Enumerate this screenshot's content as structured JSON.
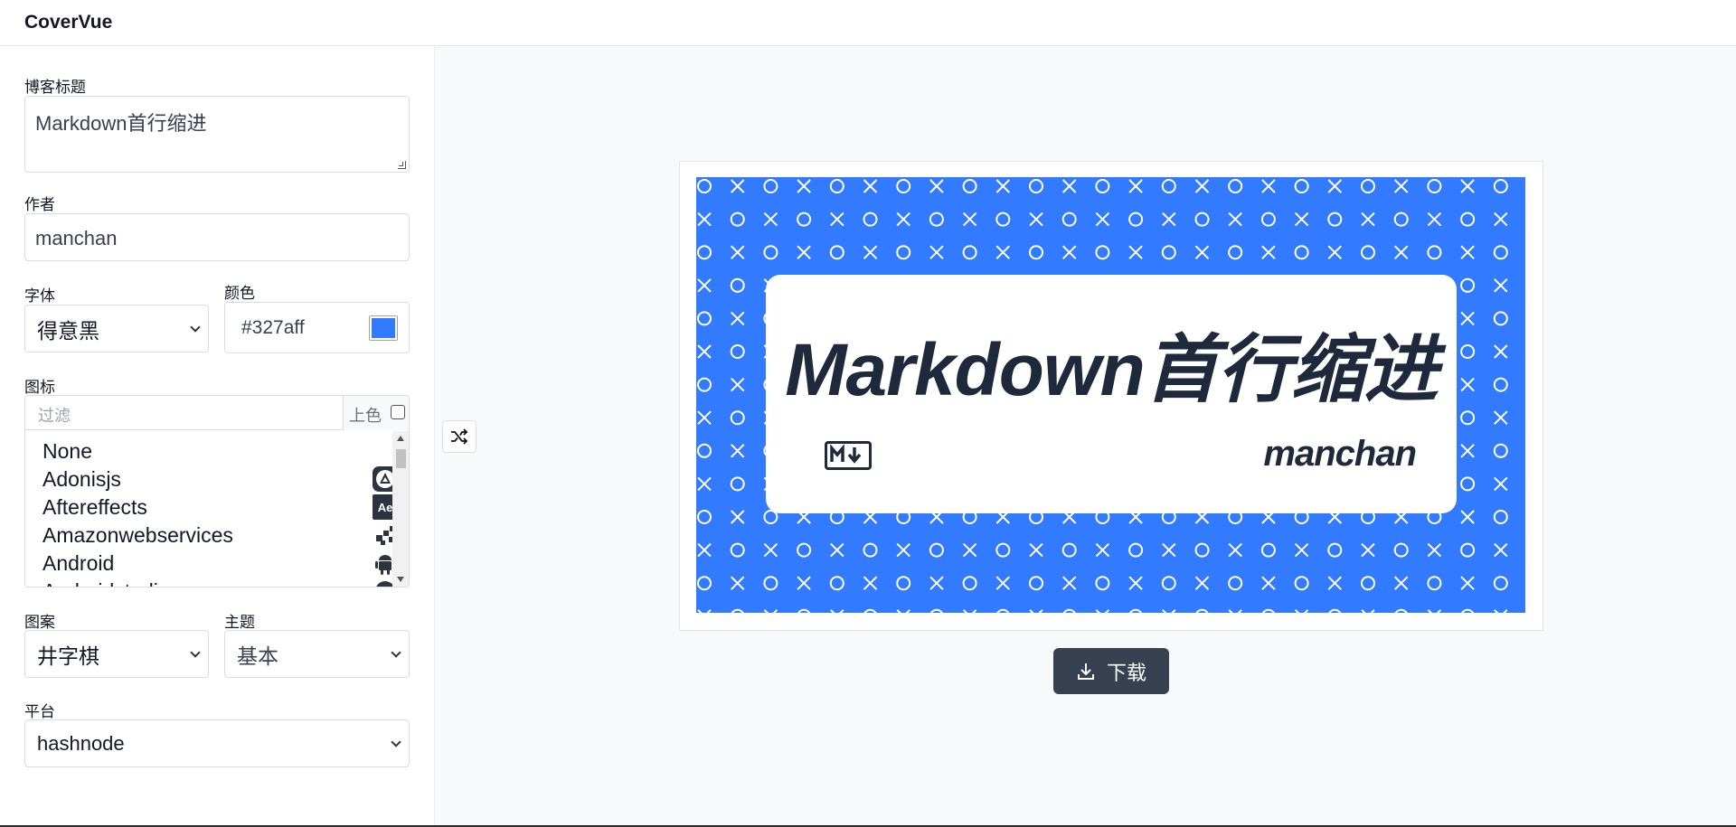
{
  "app": {
    "title": "CoverVue"
  },
  "form": {
    "title_label": "博客标题",
    "title_value": "Markdown首行缩进",
    "author_label": "作者",
    "author_value": "manchan",
    "font_label": "字体",
    "font_value": "得意黑",
    "color_label": "颜色",
    "color_value": "#327aff",
    "icon_label": "图标",
    "filter_placeholder": "过滤",
    "colorize_label": "上色",
    "pattern_label": "图案",
    "pattern_value": "井字棋",
    "theme_label": "主题",
    "theme_value": "基本",
    "platform_label": "平台",
    "platform_value": "hashnode"
  },
  "icons": [
    {
      "name": "None",
      "icon": "none"
    },
    {
      "name": "Adonisjs",
      "icon": "adonisjs-icon"
    },
    {
      "name": "Aftereffects",
      "icon": "aftereffects-icon"
    },
    {
      "name": "Amazonwebservices",
      "icon": "aws-icon"
    },
    {
      "name": "Android",
      "icon": "android-icon"
    },
    {
      "name": "Androidstudio",
      "icon": "androidstudio-icon"
    }
  ],
  "preview": {
    "title": "Markdown首行缩进",
    "author": "manchan",
    "background": "#327aff",
    "icon": "markdown-icon"
  },
  "actions": {
    "download_label": "下载"
  },
  "colors": {
    "accent": "#327aff",
    "button_dark": "#374151"
  }
}
